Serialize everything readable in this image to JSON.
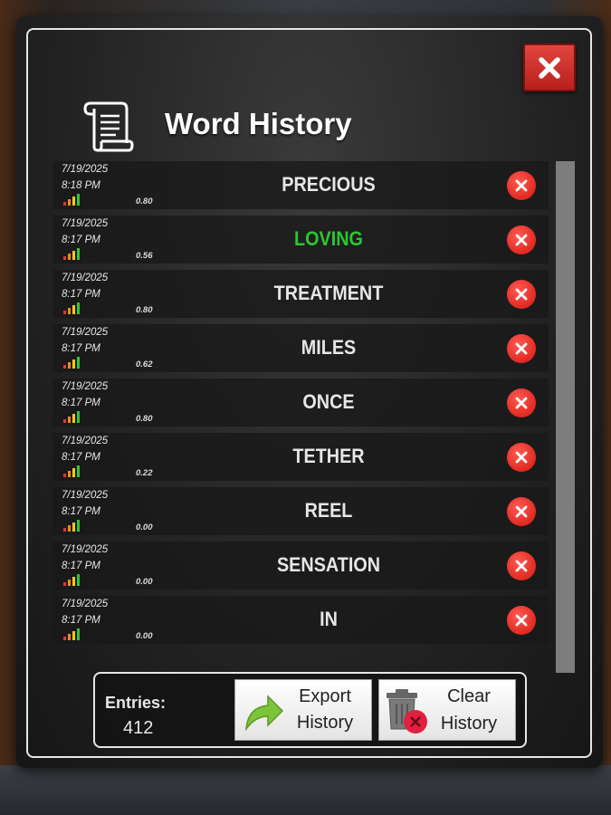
{
  "title": "Word History",
  "close_icon": "close-icon",
  "entries": [
    {
      "date": "7/19/2025",
      "time": "8:18 PM",
      "score": "0.80",
      "word": "PRECIOUS",
      "found": false
    },
    {
      "date": "7/19/2025",
      "time": "8:17 PM",
      "score": "0.56",
      "word": "LOVING",
      "found": true
    },
    {
      "date": "7/19/2025",
      "time": "8:17 PM",
      "score": "0.80",
      "word": "TREATMENT",
      "found": false
    },
    {
      "date": "7/19/2025",
      "time": "8:17 PM",
      "score": "0.62",
      "word": "MILES",
      "found": false
    },
    {
      "date": "7/19/2025",
      "time": "8:17 PM",
      "score": "0.80",
      "word": "ONCE",
      "found": false
    },
    {
      "date": "7/19/2025",
      "time": "8:17 PM",
      "score": "0.22",
      "word": "TETHER",
      "found": false
    },
    {
      "date": "7/19/2025",
      "time": "8:17 PM",
      "score": "0.00",
      "word": "REEL",
      "found": false
    },
    {
      "date": "7/19/2025",
      "time": "8:17 PM",
      "score": "0.00",
      "word": "SENSATION",
      "found": false
    },
    {
      "date": "7/19/2025",
      "time": "8:17 PM",
      "score": "0.00",
      "word": "IN",
      "found": false
    }
  ],
  "footer": {
    "entries_label": "Entries:",
    "entries_count": "412",
    "export_line1": "Export",
    "export_line2": "History",
    "clear_line1": "Clear",
    "clear_line2": "History"
  },
  "colors": {
    "found_word": "#2ec631",
    "normal_word": "#e6e6e6",
    "delete": "#e02a22",
    "close": "#d0322c",
    "bar_colors": [
      "#e03a2a",
      "#f08a1c",
      "#f2c81c",
      "#36c43a"
    ]
  }
}
